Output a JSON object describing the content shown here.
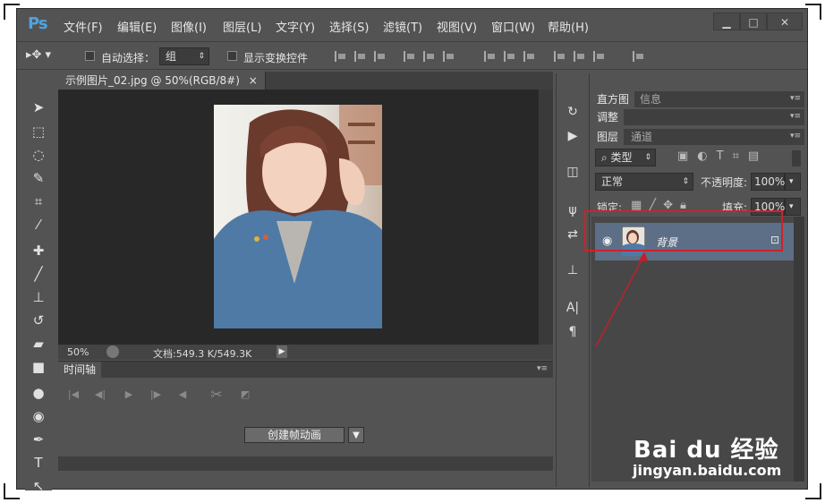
{
  "app": {
    "logo": "Ps"
  },
  "menu": [
    "文件(F)",
    "编辑(E)",
    "图像(I)",
    "图层(L)",
    "文字(Y)",
    "选择(S)",
    "滤镜(T)",
    "视图(V)",
    "窗口(W)",
    "帮助(H)"
  ],
  "window_buttons": {
    "minimize": "▁",
    "restore": "□",
    "close": "✕"
  },
  "options": {
    "auto_select_label": "自动选择：",
    "auto_select_value": "组",
    "show_transform_label": "显示变换控件"
  },
  "document": {
    "tab_title": "示例图片_02.jpg @ 50%(RGB/8#)",
    "tab_close": "×",
    "zoom": "50%",
    "doc_info": "文档:549.3 K/549.3K"
  },
  "timeline": {
    "tab_label": "时间轴",
    "create_button": "创建帧动画"
  },
  "panels": {
    "top_tabs": [
      "直方图",
      "信息"
    ],
    "adjust_tab": "调整",
    "layer_tabs": [
      "图层",
      "通道"
    ],
    "kind_filter": "类型",
    "blend_mode": "正常",
    "opacity_label": "不透明度:",
    "opacity_value": "100%",
    "lock_label": "锁定:",
    "fill_label": "填充:",
    "fill_value": "100%",
    "layer_name": "背景"
  },
  "watermark": {
    "text": "Bai du 经验",
    "url": "jingyan.baidu.com"
  },
  "colors": {
    "accent_ps": "#4fa3e0",
    "highlight_red": "#d0202a",
    "selected_layer": "#5d6f86"
  },
  "icons": [
    "move-tool-icon",
    "marquee-icon",
    "lasso-icon",
    "quick-select-icon",
    "crop-icon",
    "eyedropper-icon",
    "healing-brush-icon",
    "brush-icon",
    "stamp-icon",
    "history-brush-icon",
    "eraser-icon",
    "gradient-icon",
    "blur-icon",
    "dodge-icon",
    "pen-icon",
    "type-icon",
    "path-select-icon",
    "eye-icon",
    "lock-icon"
  ]
}
